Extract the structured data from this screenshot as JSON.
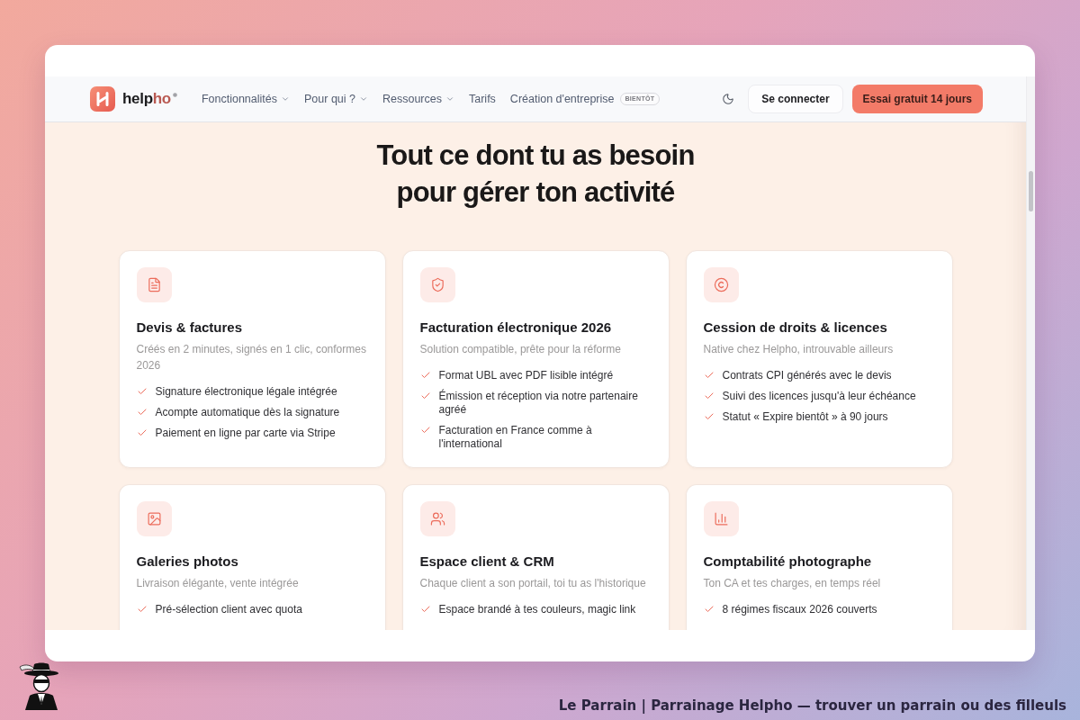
{
  "navbar": {
    "logo": {
      "main": "help",
      "accent": "ho"
    },
    "menu": [
      {
        "label": "Fonctionnalités",
        "dropdown": true
      },
      {
        "label": "Pour qui ?",
        "dropdown": true
      },
      {
        "label": "Ressources",
        "dropdown": true
      },
      {
        "label": "Tarifs",
        "dropdown": false
      },
      {
        "label": "Création d'entreprise",
        "dropdown": false,
        "badge": "BIENTÔT"
      }
    ],
    "login_button": "Se connecter",
    "cta_button": "Essai gratuit 14 jours"
  },
  "hero": {
    "title": "Tout ce dont tu as besoin pour gérer ton activité"
  },
  "features": [
    {
      "title": "Devis & factures",
      "subtitle": "Créés en 2 minutes, signés en 1 clic, conformes 2026",
      "points": [
        "Signature électronique légale intégrée",
        "Acompte automatique dès la signature",
        "Paiement en ligne par carte via Stripe"
      ]
    },
    {
      "title": "Facturation électronique 2026",
      "subtitle": "Solution compatible, prête pour la réforme",
      "points": [
        "Format UBL avec PDF lisible intégré",
        "Émission et réception via notre partenaire agréé",
        "Facturation en France comme à l'international"
      ]
    },
    {
      "title": "Cession de droits & licences",
      "subtitle": "Native chez Helpho, introuvable ailleurs",
      "points": [
        "Contrats CPI générés avec le devis",
        "Suivi des licences jusqu'à leur échéance",
        "Statut « Expire bientôt » à 90 jours"
      ]
    },
    {
      "title": "Galeries photos",
      "subtitle": "Livraison élégante, vente intégrée",
      "points": [
        "Pré-sélection client avec quota"
      ]
    },
    {
      "title": "Espace client & CRM",
      "subtitle": "Chaque client a son portail, toi tu as l'historique",
      "points": [
        "Espace brandé à tes couleurs, magic link"
      ]
    },
    {
      "title": "Comptabilité photographe",
      "subtitle": "Ton CA et tes charges, en temps réel",
      "points": [
        "8 régimes fiscaux 2026 couverts"
      ]
    }
  ],
  "caption": "Le Parrain | Parrainage Helpho — trouver un parrain ou des filleuls"
}
